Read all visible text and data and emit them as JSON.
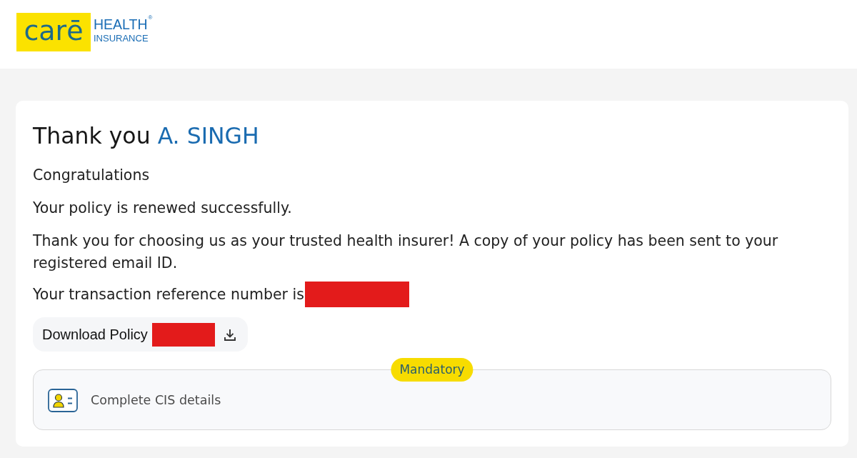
{
  "header": {
    "logo": {
      "mark": "carē",
      "line_1": "HEALTH",
      "line_2": "INSURANCE",
      "registered": "®"
    }
  },
  "card": {
    "greeting": "Thank you",
    "name": "A. SINGH",
    "messages": [
      "Congratulations",
      "Your policy is renewed successfully.",
      "Thank you for choosing us as your trusted health insurer! A copy of your policy has been sent to your registered email ID."
    ],
    "reference": {
      "label": "Your transaction reference number is",
      "redacted": true
    },
    "download_button": {
      "label": "Download Policy",
      "redacted": true
    },
    "cis_panel": {
      "badge": "Mandatory",
      "label": "Complete CIS details"
    }
  }
}
